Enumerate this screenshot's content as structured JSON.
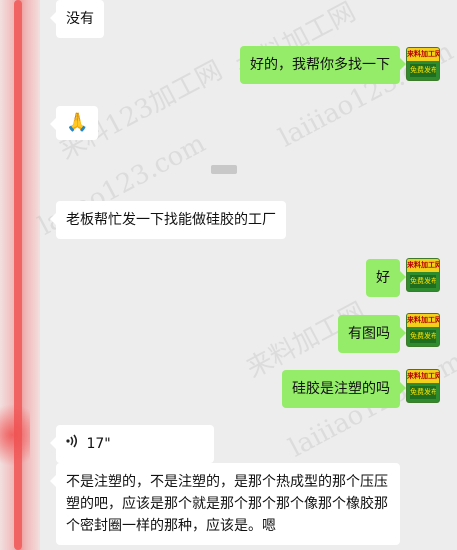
{
  "messages": [
    {
      "id": "m1",
      "side": "in",
      "text": "没有"
    },
    {
      "id": "m2",
      "side": "out",
      "text": "好的，我帮你多找一下"
    },
    {
      "id": "m3",
      "side": "in",
      "text": "🙏"
    },
    {
      "id": "m4",
      "side": "in",
      "text": "老板帮忙发一下找能做硅胶的工厂"
    },
    {
      "id": "m5",
      "side": "out",
      "text": "好"
    },
    {
      "id": "m6",
      "side": "out",
      "text": "有图吗"
    },
    {
      "id": "m7",
      "side": "out",
      "text": "硅胶是注塑的吗"
    },
    {
      "id": "m8",
      "side": "in",
      "voice_duration": "17\""
    },
    {
      "id": "m9",
      "side": "in",
      "text": "不是注塑的，不是注塑的，是那个热成型的那个压压塑的吧，应该是那个就是那个那个那个像那个橡胶那个密封圈一样的那种，应该是。嗯"
    }
  ],
  "avatar": {
    "top_text": "来料加工网",
    "bottom_text": "免费发布"
  },
  "watermarks": [
    "来料加工网",
    "laiiiao123.com",
    "laiiao123.com",
    "来料123加工网",
    "laiiiao123.com",
    "来料加工网"
  ],
  "icons": {
    "voice": "sound-wave-icon"
  },
  "colors": {
    "outgoing_bubble": "#95ec69",
    "incoming_bubble": "#ffffff",
    "background": "#ededed",
    "redaction": "#f24d4d"
  }
}
